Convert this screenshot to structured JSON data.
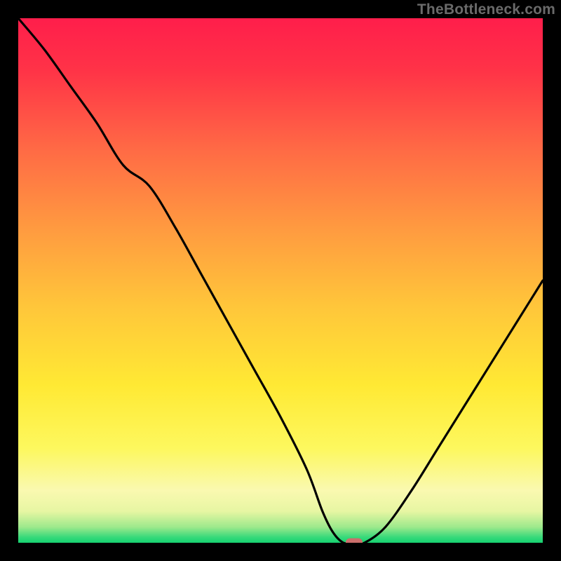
{
  "watermark": "TheBottleneck.com",
  "colors": {
    "marker": "#cb6f6c",
    "curve": "#000000",
    "frame": "#000000"
  },
  "gradient_stops": [
    {
      "pct": 0,
      "color": "#ff1e4b"
    },
    {
      "pct": 10,
      "color": "#ff3347"
    },
    {
      "pct": 25,
      "color": "#ff6a45"
    },
    {
      "pct": 40,
      "color": "#ff9a40"
    },
    {
      "pct": 55,
      "color": "#ffc63a"
    },
    {
      "pct": 70,
      "color": "#ffe934"
    },
    {
      "pct": 82,
      "color": "#fdf85e"
    },
    {
      "pct": 90,
      "color": "#faf9b0"
    },
    {
      "pct": 94,
      "color": "#e7f6a3"
    },
    {
      "pct": 97,
      "color": "#9de98c"
    },
    {
      "pct": 99,
      "color": "#35d97a"
    },
    {
      "pct": 100,
      "color": "#16d170"
    }
  ],
  "chart_data": {
    "type": "line",
    "title": "",
    "xlabel": "",
    "ylabel": "",
    "xlim": [
      0,
      100
    ],
    "ylim": [
      0,
      100
    ],
    "x": [
      0,
      5,
      10,
      15,
      20,
      25,
      30,
      35,
      40,
      45,
      50,
      55,
      58,
      60,
      62,
      64,
      66,
      70,
      75,
      80,
      85,
      90,
      95,
      100
    ],
    "values": [
      100,
      94,
      87,
      80,
      72,
      68,
      60,
      51,
      42,
      33,
      24,
      14,
      6,
      2,
      0,
      0,
      0,
      3,
      10,
      18,
      26,
      34,
      42,
      50
    ],
    "marker": {
      "x": 64,
      "y": 0
    },
    "note": "Bottleneck-style V curve. x is relative hardware match position, y is bottleneck percentage (0 = optimal, green)."
  }
}
